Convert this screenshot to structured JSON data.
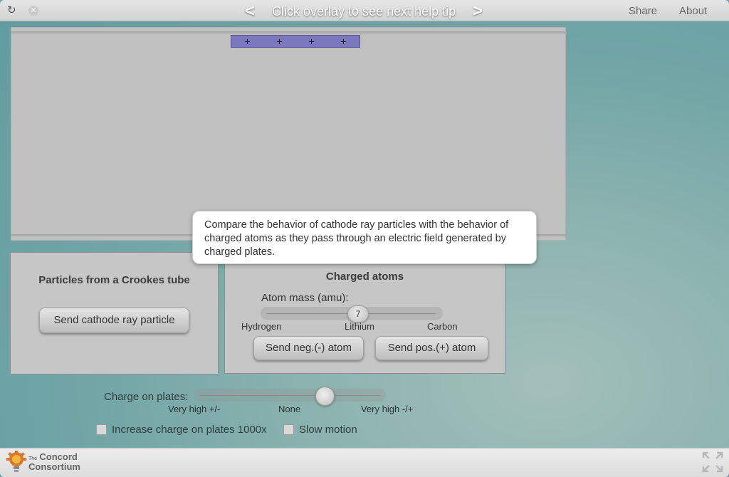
{
  "topbar": {
    "reload_icon": "reload-icon",
    "close_icon": "close-icon",
    "prev_arrow": "<",
    "help_text": "Click overlay to see next help tip",
    "next_arrow": ">",
    "share": "Share",
    "about": "About"
  },
  "plate": {
    "signs": [
      "+",
      "+",
      "+",
      "+"
    ],
    "color": "#7c78c0"
  },
  "tooltip": {
    "text": "Compare the behavior of cathode ray particles with the behavior of charged atoms as they pass through an electric field generated by charged plates."
  },
  "crookes": {
    "title": "Particles from a Crookes tube",
    "button": "Send cathode ray particle"
  },
  "atoms": {
    "title": "Charged atoms",
    "mass_label": "Atom mass (amu):",
    "mass_value": "7",
    "ticks": [
      "Hydrogen",
      "Lithium",
      "Carbon"
    ],
    "neg_button": "Send neg.(-) atom",
    "pos_button": "Send pos.(+) atom"
  },
  "charge": {
    "label": "Charge on plates:",
    "ticks": [
      "Very high +/-",
      "None",
      "Very high -/+"
    ]
  },
  "options": {
    "increase_charge": "Increase charge on plates 1000x",
    "slow_motion": "Slow motion"
  },
  "footer": {
    "logo_the": "The",
    "logo_line1": "Concord",
    "logo_line2": "Consortium",
    "fullscreen_icon": "fullscreen-icon"
  }
}
